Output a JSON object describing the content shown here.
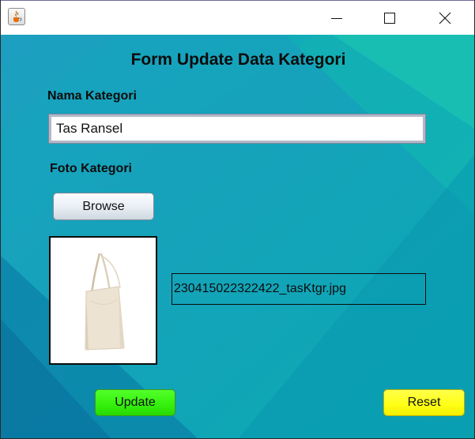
{
  "window": {
    "title": "",
    "app_icon": "java-cup-icon",
    "controls": [
      "minimize-icon",
      "maximize-icon",
      "close-icon"
    ]
  },
  "form": {
    "title": "Form Update Data Kategori",
    "nama_label": "Nama Kategori",
    "nama_value": "Tas Ransel",
    "foto_label": "Foto Kategori",
    "browse_label": "Browse",
    "image_icon": "tote-bag-image",
    "file_name": "230415022322422_tasKtgr.jpg",
    "update_label": "Update",
    "reset_label": "Reset"
  },
  "colors": {
    "background": "#0ba2b6",
    "update_button": "#34f00c",
    "reset_button": "#ffff14"
  }
}
